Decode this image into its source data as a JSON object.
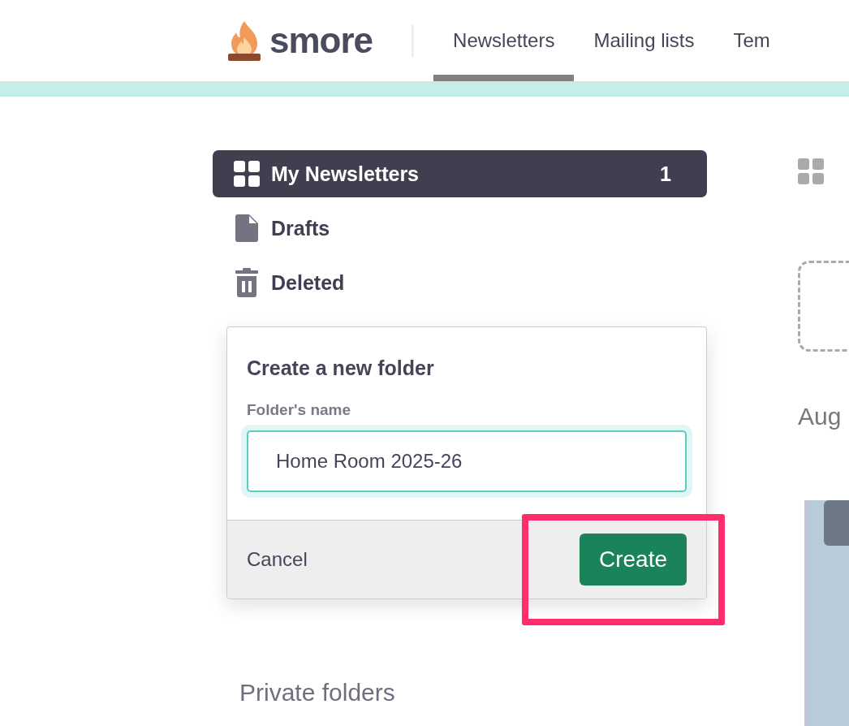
{
  "header": {
    "logo": "smore",
    "tabs": [
      {
        "label": "Newsletters",
        "selected": true
      },
      {
        "label": "Mailing lists",
        "selected": false
      },
      {
        "label": "Tem",
        "selected": false
      }
    ]
  },
  "sidebar": {
    "items": [
      {
        "kind": "grid",
        "label": "My Newsletters",
        "count": "1",
        "selected": true
      },
      {
        "kind": "file",
        "label": "Drafts",
        "selected": false
      },
      {
        "kind": "trash",
        "label": "Deleted",
        "selected": false
      }
    ],
    "section_title": "Private folders"
  },
  "dialog": {
    "title": "Create a new folder",
    "field_label": "Folder's name",
    "value": "Home Room 2025-26",
    "cancel": "Cancel",
    "confirm": "Create"
  },
  "content": {
    "date_label": "Aug"
  }
}
